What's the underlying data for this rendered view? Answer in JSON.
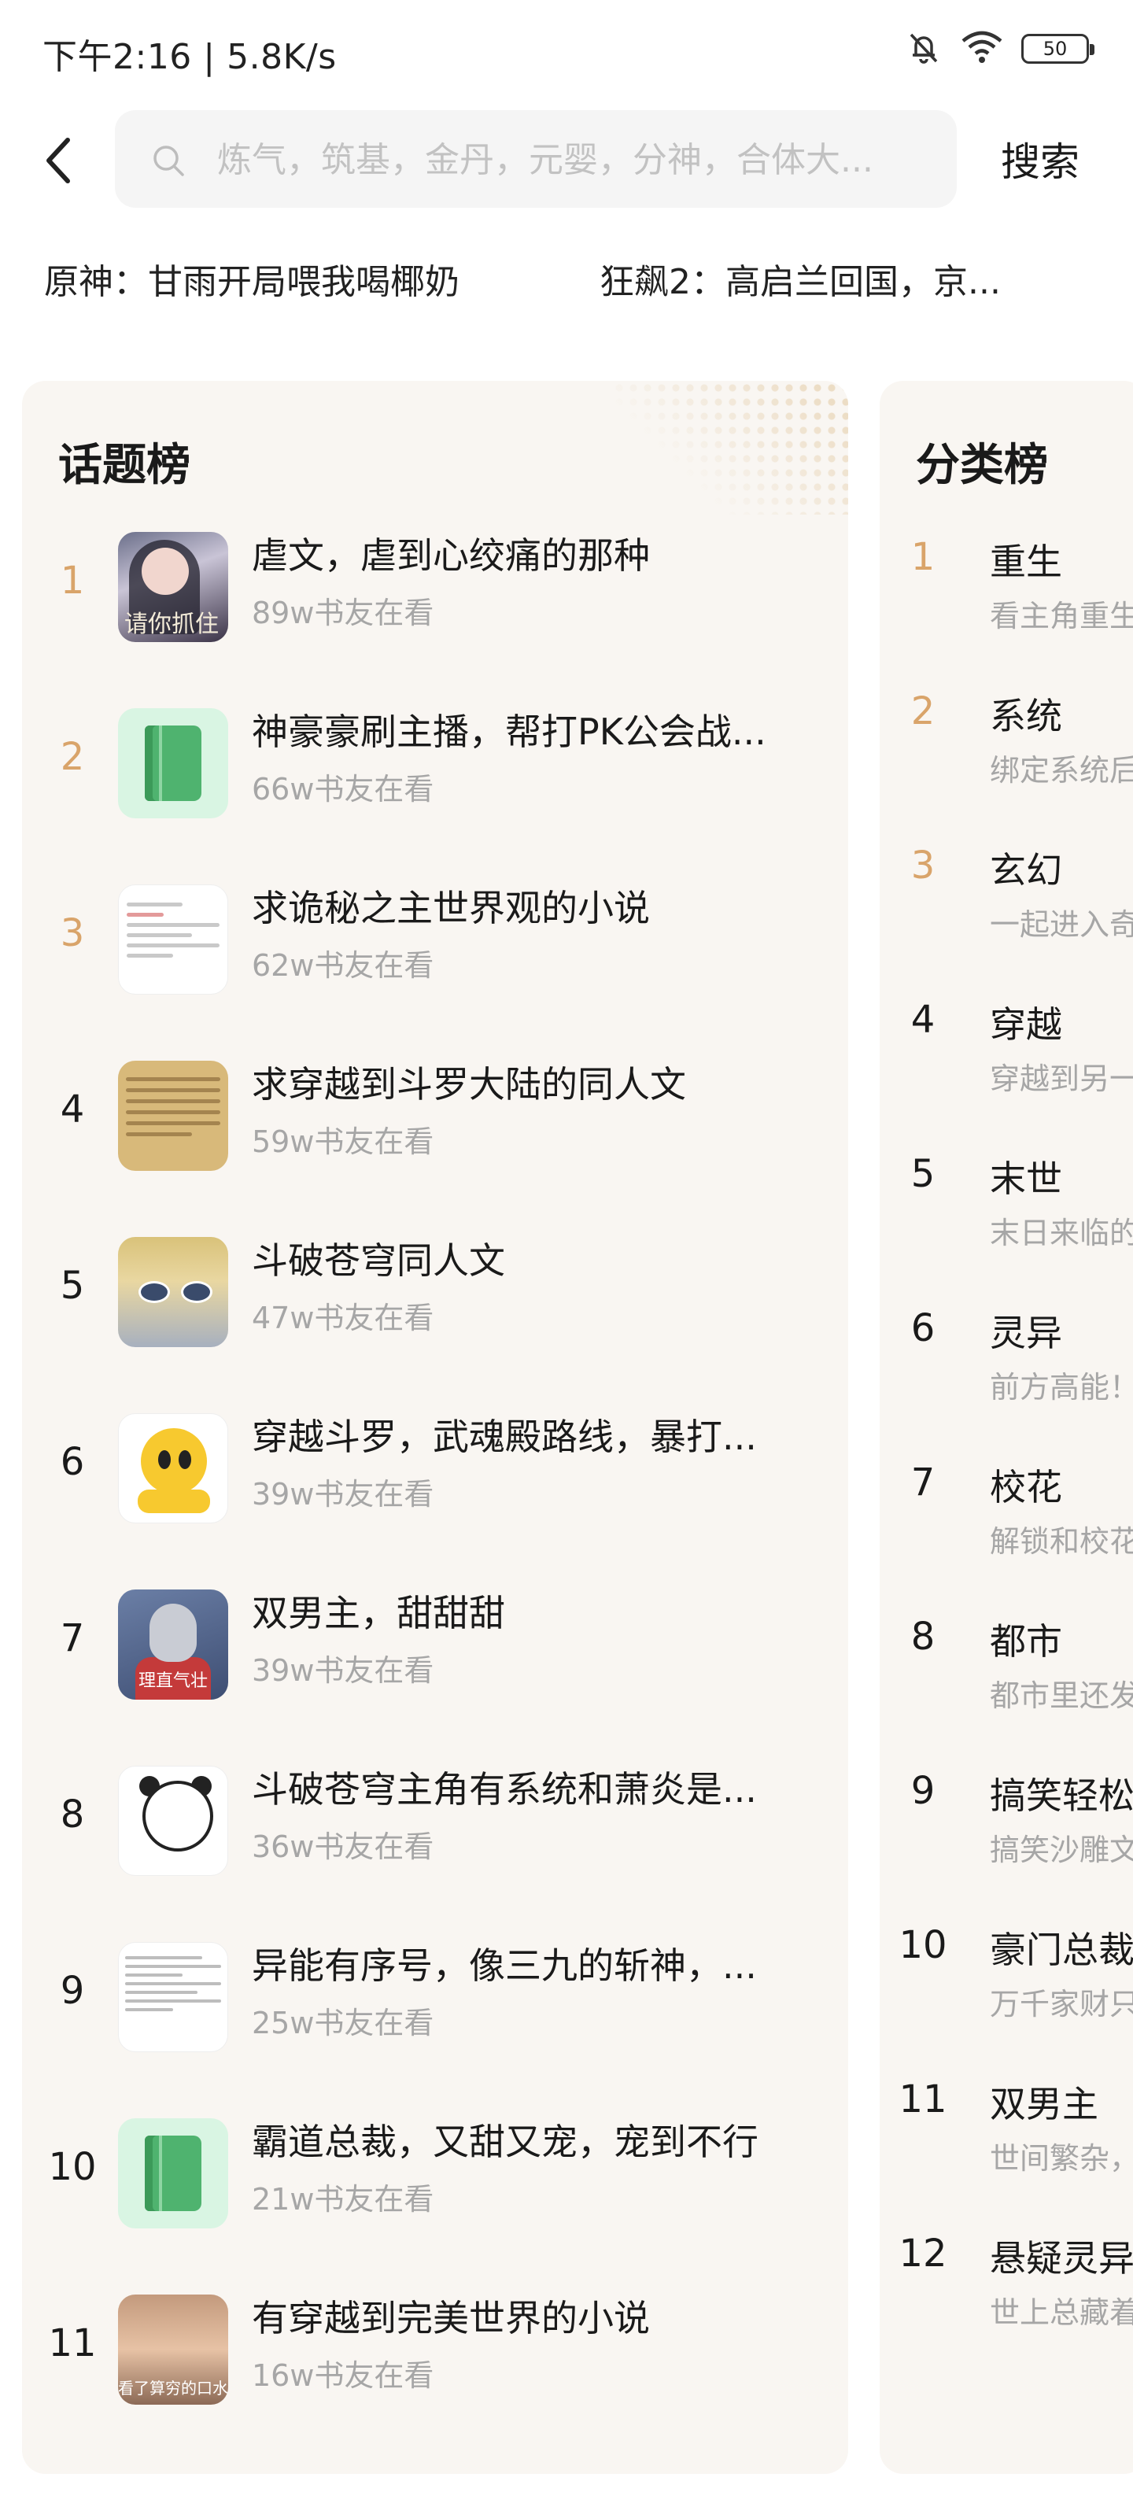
{
  "status": {
    "time": "下午2:16 | 5.8K/s",
    "battery": "50"
  },
  "search": {
    "placeholder": "炼气，筑基，金丹，元婴，分神，合体大...",
    "value": "",
    "button_label": "搜索"
  },
  "hot_searches": [
    "原神：甘雨开局喂我喝椰奶",
    "狂飙2：高启兰回国，京..."
  ],
  "topic_board": {
    "title": "话题榜",
    "items": [
      {
        "rank": "1",
        "title": "虐文，虐到心绞痛的那种",
        "readers": "89w书友在看",
        "cover_text": "请你抓住"
      },
      {
        "rank": "2",
        "title": "神豪豪刷主播，帮打PK公会战...",
        "readers": "66w书友在看"
      },
      {
        "rank": "3",
        "title": "求诡秘之主世界观的小说",
        "readers": "62w书友在看"
      },
      {
        "rank": "4",
        "title": "求穿越到斗罗大陆的同人文",
        "readers": "59w书友在看"
      },
      {
        "rank": "5",
        "title": "斗破苍穹同人文",
        "readers": "47w书友在看"
      },
      {
        "rank": "6",
        "title": "穿越斗罗，武魂殿路线，暴打...",
        "readers": "39w书友在看"
      },
      {
        "rank": "7",
        "title": "双男主，甜甜甜",
        "readers": "39w书友在看",
        "cover_text": "理直气壮"
      },
      {
        "rank": "8",
        "title": "斗破苍穹主角有系统和萧炎是...",
        "readers": "36w书友在看"
      },
      {
        "rank": "9",
        "title": "异能有序号，像三九的斩神，...",
        "readers": "25w书友在看"
      },
      {
        "rank": "10",
        "title": "霸道总裁，又甜又宠，宠到不行",
        "readers": "21w书友在看"
      },
      {
        "rank": "11",
        "title": "有穿越到完美世界的小说",
        "readers": "16w书友在看",
        "cover_text": "看了算穷的口水"
      }
    ]
  },
  "category_board": {
    "title": "分类榜",
    "items": [
      {
        "rank": "1",
        "name": "重生",
        "desc": "看主角重生"
      },
      {
        "rank": "2",
        "name": "系统",
        "desc": "绑定系统后"
      },
      {
        "rank": "3",
        "name": "玄幻",
        "desc": "一起进入奇"
      },
      {
        "rank": "4",
        "name": "穿越",
        "desc": "穿越到另一"
      },
      {
        "rank": "5",
        "name": "末世",
        "desc": "末日来临的"
      },
      {
        "rank": "6",
        "name": "灵异",
        "desc": "前方高能！"
      },
      {
        "rank": "7",
        "name": "校花",
        "desc": "解锁和校花"
      },
      {
        "rank": "8",
        "name": "都市",
        "desc": "都市里还发"
      },
      {
        "rank": "9",
        "name": "搞笑轻松",
        "desc": "搞笑沙雕文"
      },
      {
        "rank": "10",
        "name": "豪门总裁",
        "desc": "万千家财只"
      },
      {
        "rank": "11",
        "name": "双男主",
        "desc": "世间繁杂，"
      },
      {
        "rank": "12",
        "name": "悬疑灵异",
        "desc": "世上总藏着"
      }
    ]
  },
  "colors": {
    "accent_rank": "#d9a46a",
    "card_bg": "#f9f6f2",
    "muted_text": "#a6a6a6"
  }
}
